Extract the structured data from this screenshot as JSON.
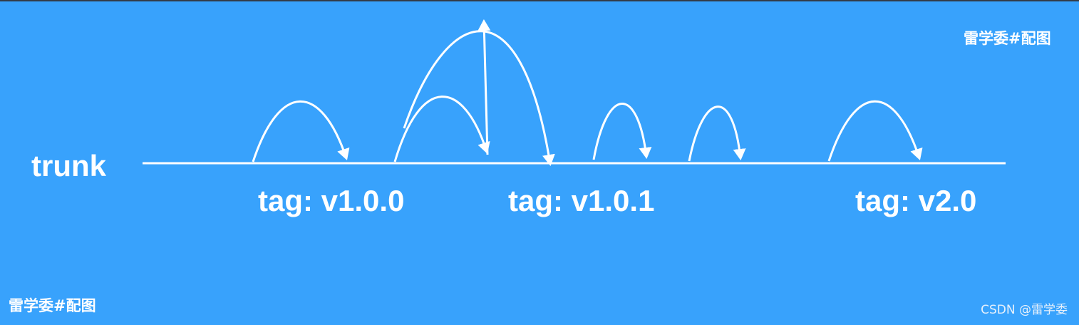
{
  "diagram": {
    "background_color": "#38a2fc",
    "line_color": "#ffffff",
    "trunk_label": "trunk",
    "tags": [
      {
        "label": "tag: v1.0.0"
      },
      {
        "label": "tag: v1.0.1"
      },
      {
        "label": "tag: v2.0"
      }
    ]
  },
  "watermarks": {
    "top_right": "雷学委#配图",
    "bottom_left": "雷学委#配图",
    "csdn": "CSDN @雷学委"
  }
}
